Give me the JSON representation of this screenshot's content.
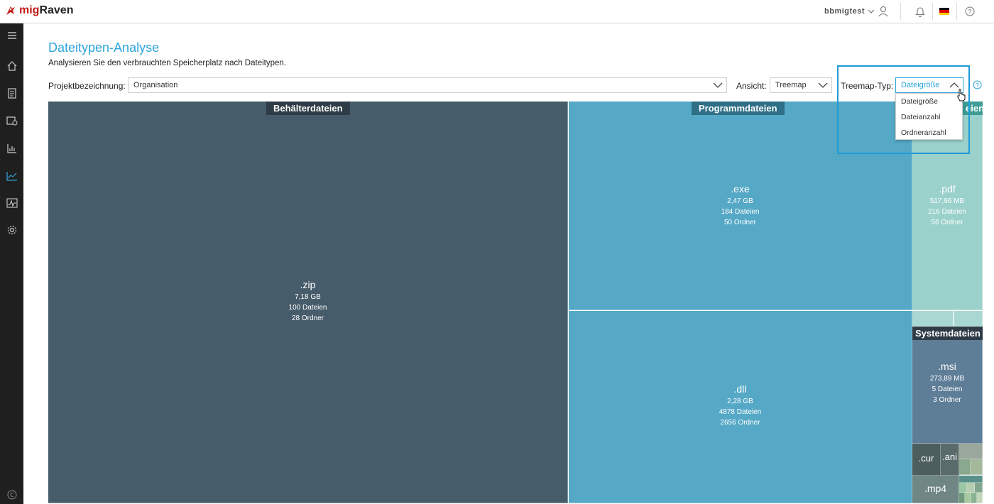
{
  "app": {
    "brand_part1": "mig",
    "brand_part2": "Raven"
  },
  "header": {
    "user": "bbmigtest"
  },
  "page": {
    "title": "Dateitypen-Analyse",
    "subtitle": "Analysieren Sie den verbrauchten Speicherplatz nach Dateitypen."
  },
  "filters": {
    "project_label": "Projektbezeichnung:",
    "project_value": "Organisation",
    "view_label": "Ansicht:",
    "view_value": "Treemap",
    "treemap_type_label": "Treemap-Typ:",
    "treemap_type_value": "Dateigröße",
    "treemap_type_options": [
      "Dateigröße",
      "Dateianzahl",
      "Ordneranzahl"
    ]
  },
  "treemap": {
    "groups": {
      "container": "Behälterdateien",
      "program": "Programmdateien",
      "documents_partial": "eien",
      "system": "Systemdateien"
    },
    "items": {
      "zip": {
        "ext": ".zip",
        "size": "7,18 GB",
        "files": "100 Dateien",
        "folders": "28 Ordner"
      },
      "exe": {
        "ext": ".exe",
        "size": "2,47 GB",
        "files": "184 Dateien",
        "folders": "50 Ordner"
      },
      "dll": {
        "ext": ".dll",
        "size": "2,28 GB",
        "files": "4878 Dateien",
        "folders": "2656 Ordner"
      },
      "pdf": {
        "ext": ".pdf",
        "size": "517,96 MB",
        "files": "216 Dateien",
        "folders": "56 Ordner"
      },
      "msi": {
        "ext": ".msi",
        "size": "273,89 MB",
        "files": "5 Dateien",
        "folders": "3 Ordner"
      },
      "cur": {
        "ext": ".cur"
      },
      "ani": {
        "ext": ".ani"
      },
      "mp4": {
        "ext": ".mp4"
      }
    },
    "colors": {
      "container": "#475c6a",
      "program": "#55a8c6",
      "documents": "#9bd1cb",
      "system": "#5e7d97"
    }
  }
}
